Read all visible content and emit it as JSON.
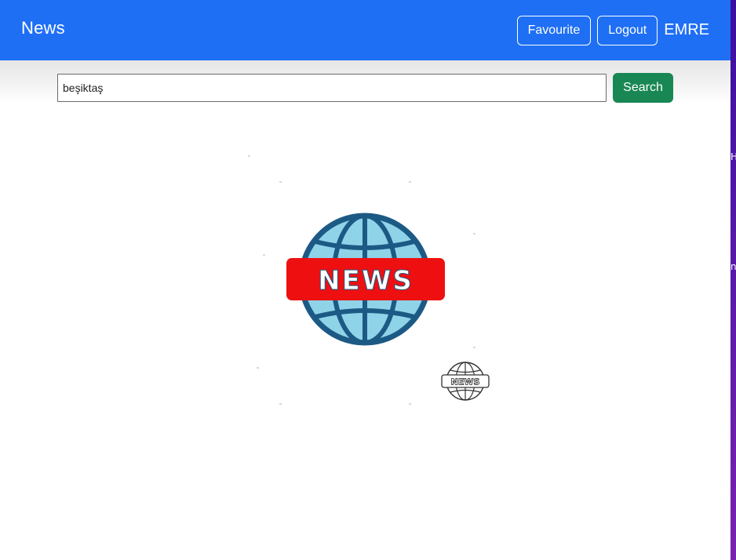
{
  "navbar": {
    "brand": "News",
    "favourite_label": "Favourite",
    "logout_label": "Logout",
    "username": "EMRE",
    "background_color": "#1f6ff5"
  },
  "search": {
    "value": "beşiktaş",
    "button_label": "Search",
    "button_color": "#198754"
  },
  "content": {
    "logo_text": "NEWS",
    "logo_icon": "globe-news-icon",
    "small_logo_icon": "globe-news-outline-icon"
  },
  "edge": {
    "glyph_top": "H",
    "glyph_bottom": "n"
  }
}
